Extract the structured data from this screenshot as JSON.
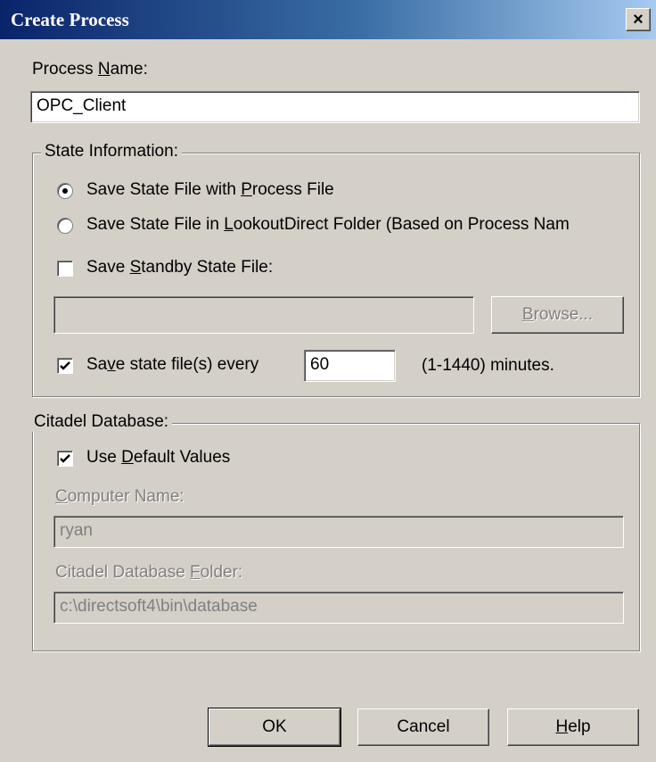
{
  "window": {
    "title": "Create Process",
    "close_glyph": "×"
  },
  "process_name": {
    "label_pre": "Process ",
    "label_u": "N",
    "label_post": "ame:",
    "value": "OPC_Client"
  },
  "state_info": {
    "legend": "State Information:",
    "radio1": {
      "pre": "Save State File with ",
      "u": "P",
      "post": "rocess File",
      "checked": true
    },
    "radio2": {
      "pre": "Save State File in ",
      "u": "L",
      "post": "ookoutDirect Folder (Based on Process Nam",
      "checked": false
    },
    "standby": {
      "pre": "Save ",
      "u": "S",
      "post": "tandby State File:",
      "checked": false,
      "path_value": ""
    },
    "browse": {
      "u": "B",
      "post": "rowse..."
    },
    "save_every": {
      "pre": "Sa",
      "u": "v",
      "post": "e state file(s) every",
      "checked": true,
      "value": "60",
      "suffix": "(1-1440) minutes."
    }
  },
  "citadel": {
    "legend": "Citadel Database:",
    "use_default": {
      "pre": "Use ",
      "u": "D",
      "post": "efault Values",
      "checked": true
    },
    "computer_name": {
      "u": "C",
      "post": "omputer Name:",
      "value": "ryan"
    },
    "db_folder": {
      "pre": "Citadel Database ",
      "u": "F",
      "post": "older:",
      "value": "c:\\directsoft4\\bin\\database"
    }
  },
  "buttons": {
    "ok": "OK",
    "cancel": "Cancel",
    "help": {
      "u": "H",
      "post": "elp"
    }
  },
  "icons": {
    "close": "close-icon",
    "check": "checkmark-icon",
    "radio_dot": "radio-dot-icon"
  }
}
